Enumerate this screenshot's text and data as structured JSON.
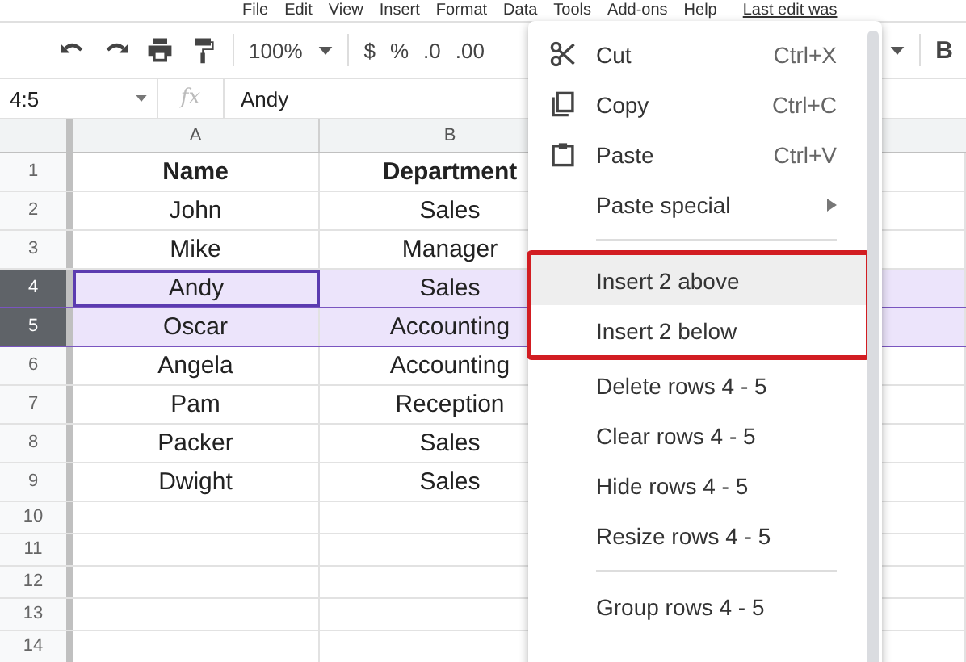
{
  "menu_bar": {
    "items": [
      "File",
      "Edit",
      "View",
      "Insert",
      "Format",
      "Data",
      "Tools",
      "Add-ons",
      "Help"
    ],
    "last_edit": "Last edit was"
  },
  "toolbar": {
    "zoom": "100%",
    "currency": "$",
    "percent": "%",
    "decrease_decimals": ".0",
    "increase_decimals": ".00",
    "bold": "B"
  },
  "formula_bar": {
    "name_box": "4:5",
    "fx": "fx",
    "value": "Andy"
  },
  "columns": [
    "A",
    "B"
  ],
  "rows": [
    {
      "number": "1",
      "kind": "header",
      "selected": false,
      "cells": [
        {
          "text": "Name",
          "active": false
        },
        {
          "text": "Department",
          "active": false
        }
      ]
    },
    {
      "number": "2",
      "kind": "data",
      "selected": false,
      "cells": [
        {
          "text": "John",
          "active": false
        },
        {
          "text": "Sales",
          "active": false
        }
      ]
    },
    {
      "number": "3",
      "kind": "data",
      "selected": false,
      "cells": [
        {
          "text": "Mike",
          "active": false
        },
        {
          "text": "Manager",
          "active": false
        }
      ]
    },
    {
      "number": "4",
      "kind": "data",
      "selected": true,
      "cells": [
        {
          "text": "Andy",
          "active": true
        },
        {
          "text": "Sales",
          "active": false
        }
      ]
    },
    {
      "number": "5",
      "kind": "data",
      "selected": true,
      "cells": [
        {
          "text": "Oscar",
          "active": false
        },
        {
          "text": "Accounting",
          "active": false
        }
      ]
    },
    {
      "number": "6",
      "kind": "data",
      "selected": false,
      "cells": [
        {
          "text": "Angela",
          "active": false
        },
        {
          "text": "Accounting",
          "active": false
        }
      ]
    },
    {
      "number": "7",
      "kind": "data",
      "selected": false,
      "cells": [
        {
          "text": "Pam",
          "active": false
        },
        {
          "text": "Reception",
          "active": false
        }
      ]
    },
    {
      "number": "8",
      "kind": "data",
      "selected": false,
      "cells": [
        {
          "text": "Packer",
          "active": false
        },
        {
          "text": "Sales",
          "active": false
        }
      ]
    },
    {
      "number": "9",
      "kind": "data",
      "selected": false,
      "cells": [
        {
          "text": "Dwight",
          "active": false
        },
        {
          "text": "Sales",
          "active": false
        }
      ]
    },
    {
      "number": "10",
      "kind": "data",
      "selected": false,
      "cells": []
    },
    {
      "number": "11",
      "kind": "data",
      "selected": false,
      "cells": []
    },
    {
      "number": "12",
      "kind": "data",
      "selected": false,
      "cells": []
    },
    {
      "number": "13",
      "kind": "data",
      "selected": false,
      "cells": []
    },
    {
      "number": "14",
      "kind": "data",
      "selected": false,
      "cells": []
    }
  ],
  "context_menu": {
    "items": [
      {
        "kind": "item",
        "label": "Cut",
        "shortcut": "Ctrl+X",
        "submenu": false,
        "hovered": false,
        "highlighted": false
      },
      {
        "kind": "item",
        "label": "Copy",
        "shortcut": "Ctrl+C",
        "submenu": false,
        "hovered": false,
        "highlighted": false
      },
      {
        "kind": "item",
        "label": "Paste",
        "shortcut": "Ctrl+V",
        "submenu": false,
        "hovered": false,
        "highlighted": false
      },
      {
        "kind": "item",
        "label": "Paste special",
        "submenu": true,
        "hovered": false,
        "highlighted": false
      },
      {
        "kind": "separator"
      },
      {
        "kind": "item",
        "label": "Insert 2 above",
        "submenu": false,
        "hovered": true,
        "highlighted": true
      },
      {
        "kind": "item",
        "label": "Insert 2 below",
        "submenu": false,
        "hovered": false,
        "highlighted": true
      },
      {
        "kind": "item",
        "label": "Delete rows 4 - 5",
        "submenu": false,
        "hovered": false,
        "highlighted": false
      },
      {
        "kind": "item",
        "label": "Clear rows 4 - 5",
        "submenu": false,
        "hovered": false,
        "highlighted": false
      },
      {
        "kind": "item",
        "label": "Hide rows 4 - 5",
        "submenu": false,
        "hovered": false,
        "highlighted": false
      },
      {
        "kind": "item",
        "label": "Resize rows 4 - 5",
        "submenu": false,
        "hovered": false,
        "highlighted": false
      },
      {
        "kind": "separator"
      },
      {
        "kind": "item",
        "label": "Group rows 4 - 5",
        "submenu": false,
        "hovered": false,
        "highlighted": false
      }
    ]
  }
}
